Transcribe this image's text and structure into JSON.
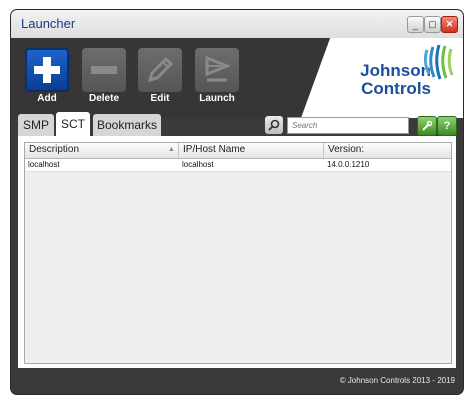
{
  "window": {
    "title": "Launcher"
  },
  "toolbar": {
    "add_label": "Add",
    "delete_label": "Delete",
    "edit_label": "Edit",
    "launch_label": "Launch"
  },
  "logo": {
    "line1": "Johnson",
    "line2": "Controls"
  },
  "tabs": [
    {
      "label": "SMP"
    },
    {
      "label": "SCT"
    },
    {
      "label": "Bookmarks"
    }
  ],
  "active_tab": "SCT",
  "search": {
    "placeholder": "Search"
  },
  "table": {
    "columns": [
      "Description",
      "IP/Host Name",
      "Version:"
    ],
    "rows": [
      [
        "localhost",
        "localhost",
        "14.0.0.1210"
      ]
    ]
  },
  "footer": {
    "copyright": "© Johnson Controls 2013 - 2019"
  },
  "colors": {
    "accent": "#1d63c9",
    "brand": "#1b4f9c",
    "chrome": "#3a3a3a"
  }
}
